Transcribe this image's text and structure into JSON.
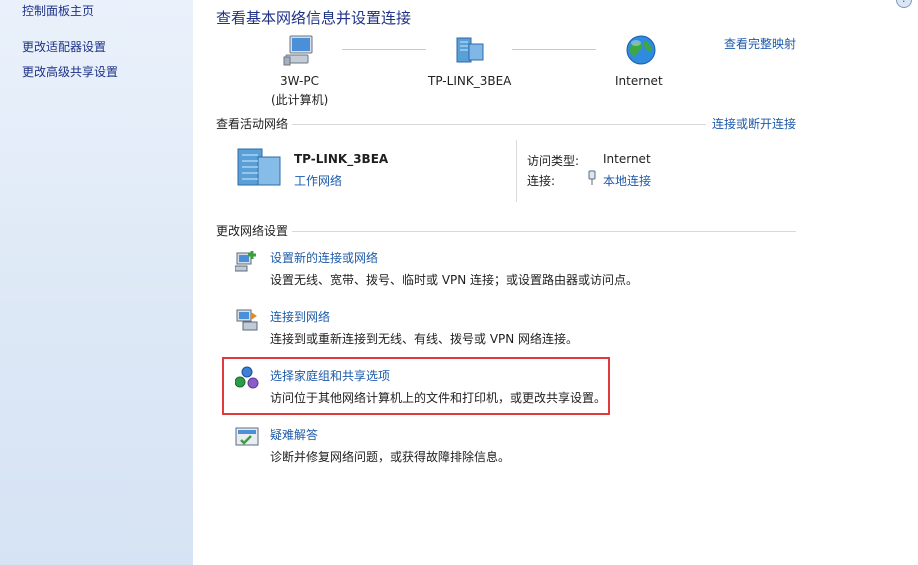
{
  "sidebar": {
    "items": [
      {
        "label": "控制面板主页"
      },
      {
        "label": "更改适配器设置"
      },
      {
        "label": "更改高级共享设置"
      }
    ]
  },
  "header": {
    "title": "查看基本网络信息并设置连接",
    "full_map_link": "查看完整映射"
  },
  "network_map": {
    "nodes": [
      {
        "name": "3W-PC",
        "sub": "(此计算机)",
        "icon": "computer-icon"
      },
      {
        "name": "TP-LINK_3BEA",
        "sub": "",
        "icon": "network-icon"
      },
      {
        "name": "Internet",
        "sub": "",
        "icon": "globe-icon"
      }
    ]
  },
  "active_networks": {
    "label": "查看活动网络",
    "connect_link": "连接或断开连接",
    "network_name": "TP-LINK_3BEA",
    "network_type": "工作网络",
    "access_type_label": "访问类型:",
    "access_type_value": "Internet",
    "connection_label": "连接:",
    "connection_value": "本地连接"
  },
  "change_settings": {
    "label": "更改网络设置",
    "items": [
      {
        "title": "设置新的连接或网络",
        "desc": "设置无线、宽带、拨号、临时或 VPN 连接；或设置路由器或访问点。",
        "icon": "new-connection-icon"
      },
      {
        "title": "连接到网络",
        "desc": "连接到或重新连接到无线、有线、拨号或 VPN 网络连接。",
        "icon": "connect-network-icon"
      },
      {
        "title": "选择家庭组和共享选项",
        "desc": "访问位于其他网络计算机上的文件和打印机，或更改共享设置。",
        "icon": "homegroup-icon"
      },
      {
        "title": "疑难解答",
        "desc": "诊断并修复网络问题，或获得故障排除信息。",
        "icon": "troubleshoot-icon"
      }
    ]
  },
  "colors": {
    "link": "#1e5aa8",
    "title": "#1e3287",
    "highlight": "#e0393e",
    "sidebar_bg": "#dde8f6"
  }
}
